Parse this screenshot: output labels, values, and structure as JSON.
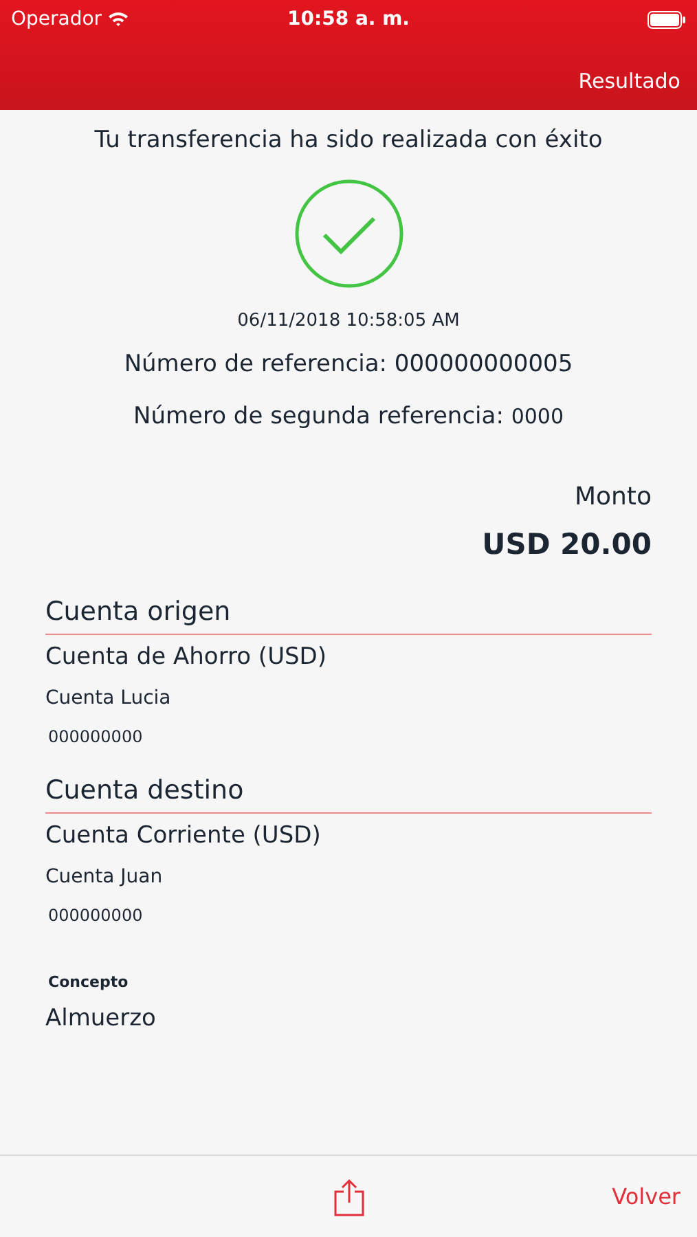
{
  "status_bar": {
    "carrier": "Operador",
    "time": "10:58 a. m."
  },
  "nav_bar": {
    "title": "Resultado"
  },
  "message": "Tu transferencia ha sido realizada con éxito",
  "success": true,
  "datetime": "06/11/2018 10:58:05 AM",
  "reference": {
    "label": "Número de referencia:",
    "value": "000000000005"
  },
  "second_reference": {
    "label": "Número de segunda referencia:",
    "value": "0000"
  },
  "amount": {
    "label": "Monto",
    "value": "USD 20.00"
  },
  "sections": [
    {
      "title": "Cuenta origen",
      "account_type": "Cuenta de Ahorro (USD)",
      "account_name": "Cuenta Lucia",
      "account_number": "000000000"
    },
    {
      "title": "Cuenta destino",
      "account_type": "Cuenta Corriente (USD)",
      "account_name": "Cuenta Juan",
      "account_number": "000000000"
    }
  ],
  "concept": {
    "label": "Concepto",
    "value": "Almuerzo"
  },
  "toolbar": {
    "back": "Volver"
  }
}
